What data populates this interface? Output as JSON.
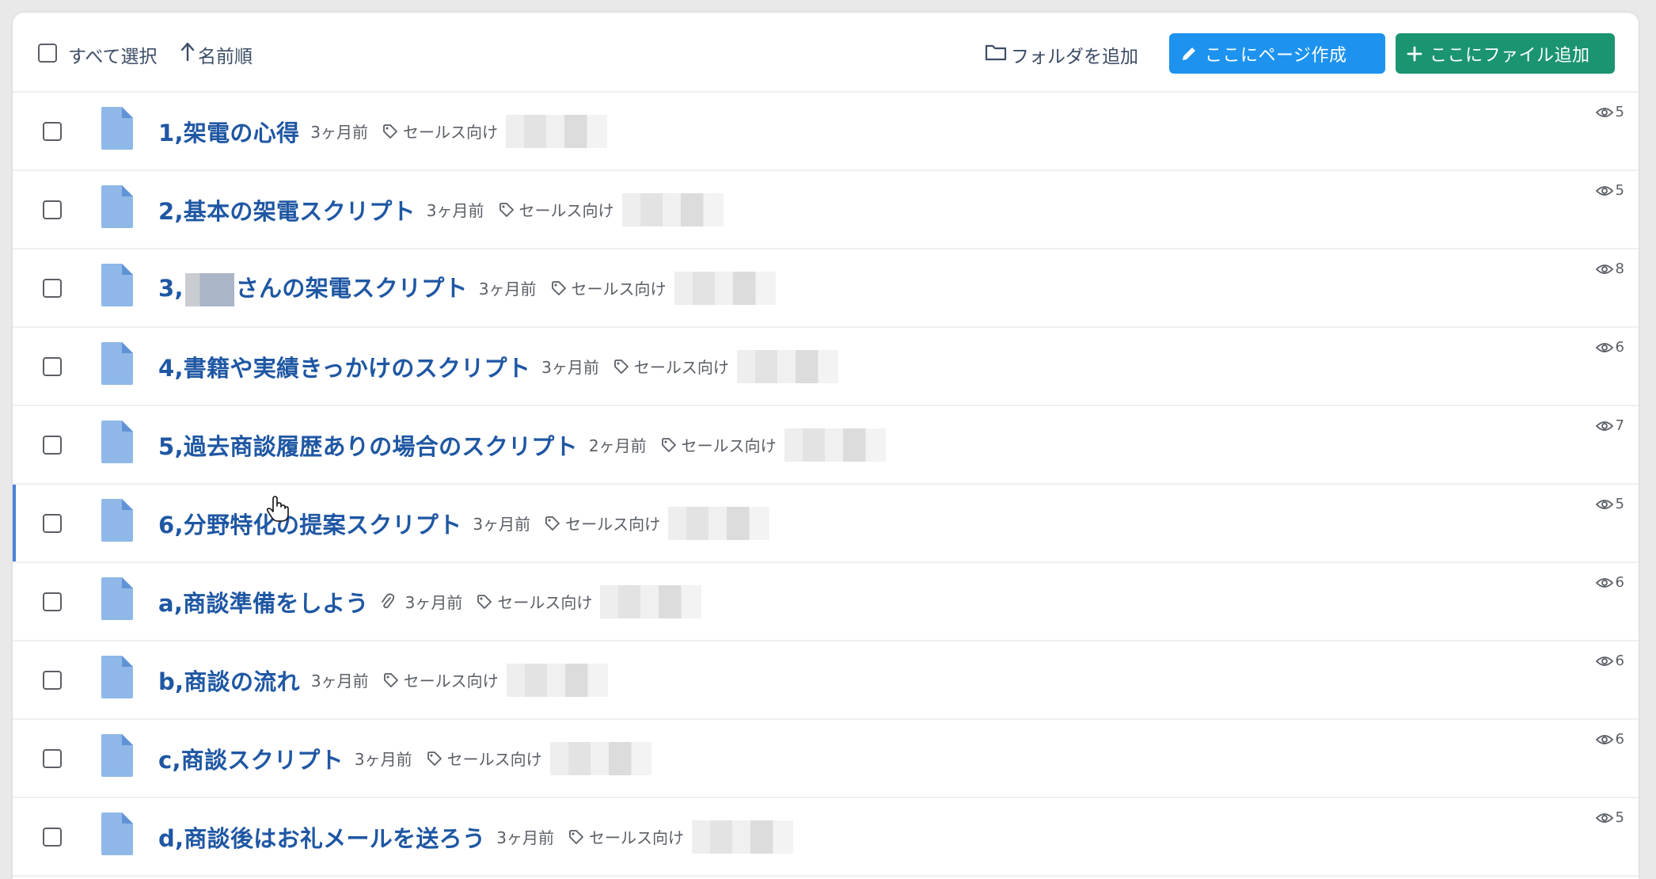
{
  "toolbar": {
    "select_all_label": "すべて選択",
    "sort_label": "名前順",
    "add_folder_label": "フォルダを追加",
    "create_page_label": "ここにページ作成",
    "add_file_label": "ここにファイル追加",
    "colors": {
      "create_page_bg": "#1d93ef",
      "add_file_bg": "#1b9471"
    }
  },
  "items": [
    {
      "title": "1,架電の心得",
      "date": "3ヶ月前",
      "tag": "セールス向け",
      "views": "5"
    },
    {
      "title": "2,基本の架電スクリプト",
      "date": "3ヶ月前",
      "tag": "セールス向け",
      "views": "5"
    },
    {
      "title_prefix": "3,",
      "title_suffix": "さんの架電スクリプト",
      "date": "3ヶ月前",
      "tag": "セールス向け",
      "views": "8"
    },
    {
      "title": "4,書籍や実績きっかけのスクリプト",
      "date": "3ヶ月前",
      "tag": "セールス向け",
      "views": "6"
    },
    {
      "title": "5,過去商談履歴ありの場合のスクリプト",
      "date": "2ヶ月前",
      "tag": "セールス向け",
      "views": "7"
    },
    {
      "title": "6,分野特化の提案スクリプト",
      "date": "3ヶ月前",
      "tag": "セールス向け",
      "views": "5"
    },
    {
      "title": "a,商談準備をしよう",
      "date": "3ヶ月前",
      "tag": "セールス向け",
      "views": "6"
    },
    {
      "title": "b,商談の流れ",
      "date": "3ヶ月前",
      "tag": "セールス向け",
      "views": "6"
    },
    {
      "title": "c,商談スクリプト",
      "date": "3ヶ月前",
      "tag": "セールス向け",
      "views": "6"
    },
    {
      "title": "d,商談後はお礼メールを送ろう",
      "date": "3ヶ月前",
      "tag": "セールス向け",
      "views": "5"
    }
  ],
  "colors": {
    "title": "#1f57a3",
    "doc_icon": "#8fb8e8",
    "active_bar": "#4a82d8"
  }
}
